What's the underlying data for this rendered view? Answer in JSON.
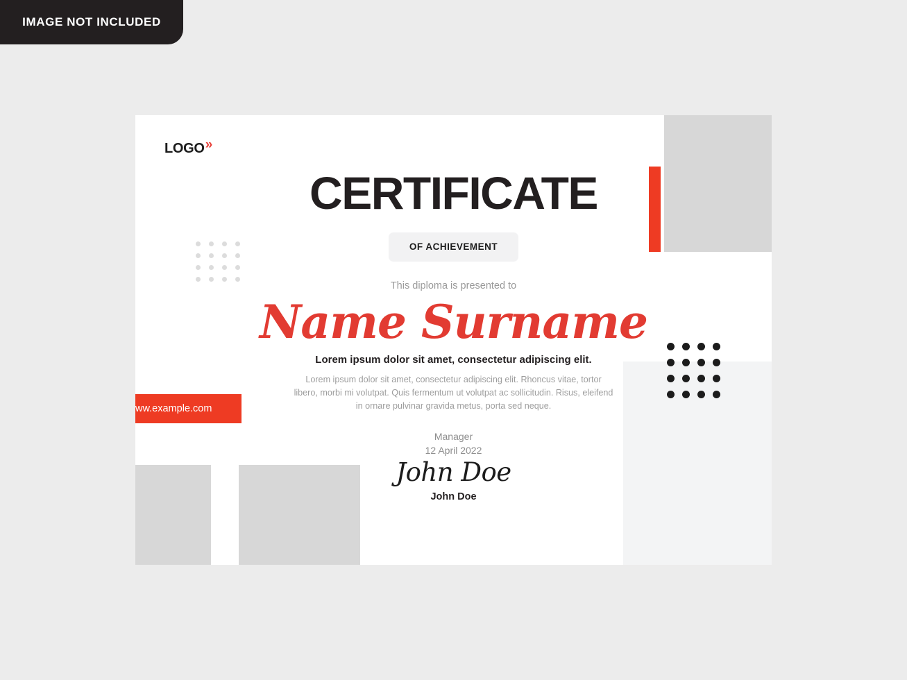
{
  "notice": {
    "label": "IMAGE NOT INCLUDED"
  },
  "certificate": {
    "logo": {
      "text": "LOGO",
      "chevrons": "»"
    },
    "title": "CERTIFICATE",
    "subtitle": "OF ACHIEVEMENT",
    "presented_to": "This diploma is presented to",
    "recipient_name": "Name Surname",
    "lead_line": "Lorem ipsum dolor sit amet, consectetur adipiscing elit.",
    "body_text": "Lorem ipsum dolor sit amet, consectetur adipiscing elit. Rhoncus vitae, tortor libero, morbi mi volutpat. Quis fermentum ut volutpat ac sollicitudin. Risus, eleifend in ornare pulvinar gravida metus, porta sed neque.",
    "role": "Manager",
    "date": "12 April 2022",
    "signature": "John Doe",
    "signer_name": "John Doe",
    "website": "ww.example.com"
  },
  "colors": {
    "accent_red": "#ee3b23",
    "name_red": "#e23b32",
    "dark": "#231f20",
    "placeholder_gray": "#d7d7d7",
    "panel_gray": "#f3f4f5",
    "page_background": "#ececec"
  }
}
